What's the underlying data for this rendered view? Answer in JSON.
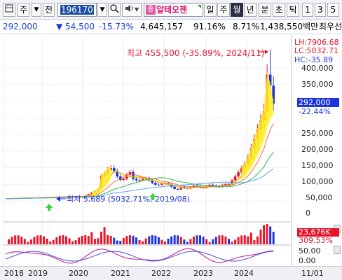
{
  "toolbar": {
    "mode_label": "주",
    "prev_label": "전",
    "code": "196170",
    "stock_badge": "종",
    "stock_name": "알테오젠",
    "periods": [
      "일",
      "주",
      "월",
      "년",
      "분",
      "초",
      "틱"
    ],
    "active_period": "월",
    "pages": [
      "1",
      "3",
      "5"
    ]
  },
  "info": {
    "price": "292,000",
    "change": "▼ 54,500",
    "change_pct": "-15.73%",
    "volume": "4,645,157",
    "ratio1": "91.16%",
    "ratio2": "8.71%",
    "amount": "1,438,550백만",
    "tag": "최우선"
  },
  "annotations": {
    "high": "최고 455,500 (-35.89%, 2024/11)",
    "low": "최저 5,689 (5032.71%, 2019/08)",
    "lh": "LH:7906.68",
    "lc": "LC:5032.71",
    "hc": "HC:-35.89",
    "current_price": "292,000",
    "current_pct": "-22.44%",
    "volume_value": "23,676K",
    "volume_pct": "309.53%"
  },
  "colors": {
    "up": "#e8152a",
    "down": "#1c34e0",
    "ma5": "#e6b800",
    "ma20": "#ff6a3d",
    "ma60": "#2bb84a",
    "ma120": "#5aa0ff",
    "accent": "#1c4fa3"
  },
  "chart_data": {
    "type": "bar",
    "title": "",
    "y_ticks": [
      "400,000",
      "350,000",
      "300,000",
      "250,000",
      "200,000",
      "150,000",
      "100,000",
      "50,000",
      "0"
    ],
    "osc_ticks": [
      "50.00",
      "0.00"
    ],
    "x_ticks": [
      "2018",
      "2019",
      "2020",
      "2021",
      "2022",
      "2023",
      "2024",
      "11/01"
    ],
    "ylim": [
      0,
      455500
    ]
  }
}
